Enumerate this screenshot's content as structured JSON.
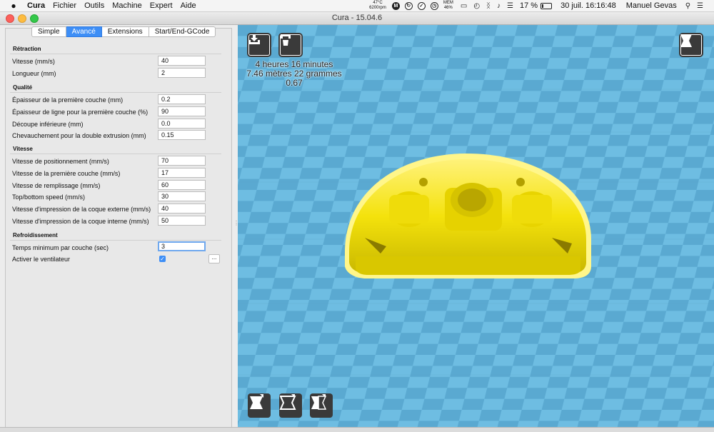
{
  "menubar": {
    "apple": "",
    "app_name": "Cura",
    "menus": [
      "Fichier",
      "Outils",
      "Machine",
      "Expert",
      "Aide"
    ],
    "temp": "47°C",
    "rpm": "6200rpm",
    "mem_label": "MEM",
    "mem_value": "46%",
    "battery_text": "17 %",
    "datetime": "30 juil.  16:16:48",
    "user": "Manuel Gevas"
  },
  "window": {
    "title": "Cura - 15.04.6"
  },
  "tabs": [
    {
      "label": "Simple",
      "active": false
    },
    {
      "label": "Avancé",
      "active": true
    },
    {
      "label": "Extensions",
      "active": false
    },
    {
      "label": "Start/End-GCode",
      "active": false
    }
  ],
  "sections": {
    "retraction": {
      "title": "Rétraction",
      "rows": [
        {
          "label": "Vitesse (mm/s)",
          "value": "40"
        },
        {
          "label": "Longueur (mm)",
          "value": "2"
        }
      ]
    },
    "qualite": {
      "title": "Qualité",
      "rows": [
        {
          "label": "Épaisseur de la première couche (mm)",
          "value": "0.2"
        },
        {
          "label": "Épaisseur de ligne pour la première couche (%)",
          "value": "90"
        },
        {
          "label": "Découpe inférieure (mm)",
          "value": "0.0"
        },
        {
          "label": "Chevauchement pour la double extrusion (mm)",
          "value": "0.15"
        }
      ]
    },
    "vitesse": {
      "title": "Vitesse",
      "rows": [
        {
          "label": "Vitesse de positionnement (mm/s)",
          "value": "70"
        },
        {
          "label": "Vitesse de la première couche (mm/s)",
          "value": "17"
        },
        {
          "label": "Vitesse de remplissage (mm/s)",
          "value": "60"
        },
        {
          "label": "Top/bottom speed (mm/s)",
          "value": "30"
        },
        {
          "label": "Vitesse d'impression de la coque externe (mm/s)",
          "value": "40"
        },
        {
          "label": "Vitesse d'impression de la coque interne (mm/s)",
          "value": "50"
        }
      ]
    },
    "refroidissement": {
      "title": "Refroidissement",
      "rows": [
        {
          "label": "Temps minimum par couche (sec)",
          "value": "3"
        }
      ],
      "fan_label": "Activer le ventilateur",
      "fan_checked": true,
      "more_label": "..."
    }
  },
  "print_info": {
    "time": "4 heures 16 minutes",
    "material": "7.46 mètres 22 grammes",
    "cost": "0.67"
  },
  "icons": {
    "load": "load-model-icon",
    "print": "print-icon",
    "view_mode": "view-mode-icon",
    "rotate": "rotate-icon",
    "scale": "scale-icon",
    "mirror": "mirror-icon"
  },
  "colors": {
    "accent": "#3d8ef6",
    "viewport": "#6ebde2",
    "model": "#f4e20c"
  }
}
